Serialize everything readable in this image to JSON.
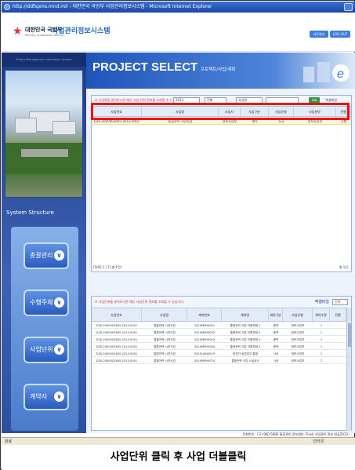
{
  "window": {
    "title": "http://ddfspms.mnd.mil - 대한민국 국방부 사업관리정보시스템 - Microsoft Internet Explorer"
  },
  "header": {
    "ministry": "대한민국 국방부",
    "ministry_sub": "Ministry of National Defense",
    "system_name": "사업관리정보시스템",
    "btn_left": "자료접속",
    "btn_logout": "LOG-OUT"
  },
  "left_panel": {
    "head": "Project Management Information System",
    "section_title": "System Structure",
    "menu": [
      {
        "label": "총괄관리"
      },
      {
        "label": "수행주체"
      },
      {
        "label": "사업단위"
      },
      {
        "label": "계약자"
      }
    ]
  },
  "main": {
    "title": "PROJECT SELECT",
    "title_sub": "프로젝트/사업/계획",
    "panel1": {
      "filter_note": "※ 사업명을 클릭하시면 해당 사업 단위 정보를 조회할 수 있습니다.",
      "filter_year": "2013",
      "filter_status": "진행",
      "filter_type": "사업명",
      "search_label": "조회",
      "excel_label": "엑셀파일",
      "columns": [
        "사업번호",
        "사업명",
        "사업자",
        "사업구분",
        "사업유형",
        "사업분야",
        "진행"
      ],
      "row": [
        "D30-2000002845-2013-0001",
        "통합전력 시연사업",
        "정보사업부",
        "계속",
        "신규",
        "정보사업부",
        "진행"
      ],
      "count_text": "[목록] 1 / 1 [총 1건]",
      "page_text": "총 1건"
    },
    "panel2": {
      "note": "※ 사업단위를 클릭하시면 해당 사업단위 정보를 조회할 수 있습니다.",
      "excel_label": "엑셀파일",
      "sel": "전체",
      "columns": [
        "사업번호",
        "사업명",
        "계약번호",
        "계약명",
        "계약구분",
        "사업유형",
        "수행부서",
        "계약수량",
        "진행"
      ],
      "rows": [
        [
          "D30-2000002845-2013-0001",
          "통합전력 시연사업",
          "2010MPH0001",
          "통합전력 사업 지원체계 1",
          "용역",
          "정보사업부",
          "1"
        ],
        [
          "D30-2000002845-2013-0001",
          "통합전력 시연사업",
          "2010MPH0002",
          "통합전력 사업 지원체계 2",
          "용역",
          "정보사업부",
          "1"
        ],
        [
          "D30-2000002845-2013-0001",
          "통합전력 시연사업",
          "2010MPH0003",
          "통합전력 사업 지원체계 3",
          "용역",
          "정보사업부",
          "1"
        ],
        [
          "D30-2000002845-2013-0001",
          "통합전력 시연사업",
          "2010MPH0004",
          "통합전력 사업 지원체계 4",
          "용역",
          "정보사업부",
          "1"
        ],
        [
          "D30-2000002845-2013-0001",
          "통합전력 시연사업",
          "2010UAH0019",
          "비전자 상업업무 통합",
          "시공",
          "정보사업부",
          "1"
        ],
        [
          "D30-2000002845-2013-0001",
          "통합전력 시연사업",
          "2010MPH0074",
          "통합전력 사업 시설공사",
          "시공",
          "정보사업부",
          "1"
        ]
      ]
    }
  },
  "footer": {
    "info": "전화번호 : (구) 900-5800     통합관리 정보센터, Flash 사업관리 정보 한글2013 ..."
  },
  "statusbar": {
    "left": "완료",
    "right": "인터넷"
  },
  "caption": "사업단위 클릭 후 사업 더블클릭"
}
